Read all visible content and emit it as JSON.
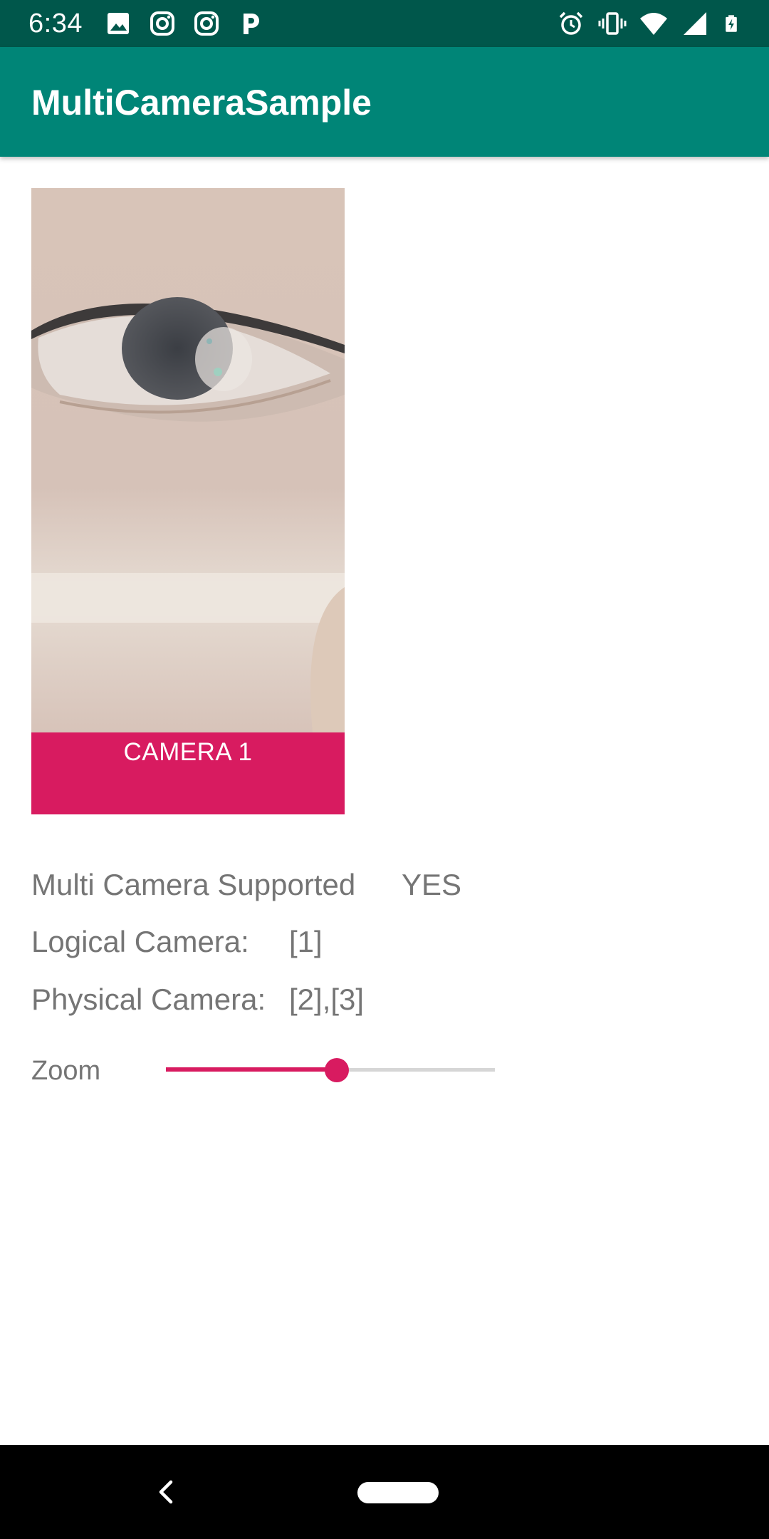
{
  "status_bar": {
    "time": "6:34",
    "left_icons": [
      "image-icon",
      "instagram-icon",
      "instagram-icon",
      "pandora-icon"
    ],
    "right_icons": [
      "alarm-icon",
      "vibrate-icon",
      "wifi-icon",
      "cell-signal-icon",
      "battery-icon"
    ]
  },
  "app_bar": {
    "title": "MultiCameraSample"
  },
  "camera": {
    "button_label": "CAMERA 1"
  },
  "info": {
    "multi_camera_label": "Multi Camera Supported",
    "multi_camera_value": "YES",
    "logical_label": "Logical Camera:",
    "logical_value": "[1]",
    "physical_label": "Physical Camera:",
    "physical_value": "[2],[3]"
  },
  "zoom": {
    "label": "Zoom",
    "value_fraction": 0.52
  },
  "colors": {
    "primary": "#008577",
    "primary_dark": "#00574b",
    "accent": "#d81b60",
    "text_secondary": "#757575"
  }
}
